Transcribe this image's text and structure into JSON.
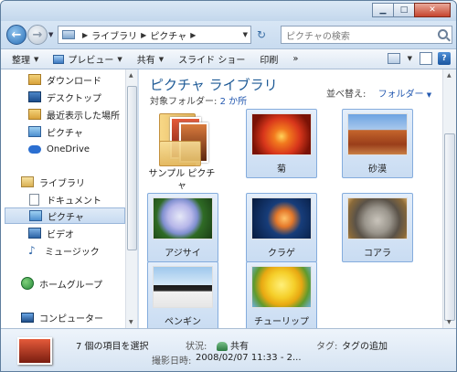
{
  "address": {
    "crumbs": [
      "ライブラリ",
      "ピクチャ"
    ]
  },
  "search": {
    "placeholder": "ピクチャの検索"
  },
  "toolbar": {
    "organize": "整理",
    "preview": "プレビュー",
    "share": "共有",
    "slideshow": "スライド ショー",
    "print": "印刷",
    "more": "»"
  },
  "navpane": {
    "favorites": [
      {
        "label": "ダウンロード",
        "icon": "download-folder-icon"
      },
      {
        "label": "デスクトップ",
        "icon": "desktop-icon"
      },
      {
        "label": "最近表示した場所",
        "icon": "recent-places-icon"
      },
      {
        "label": "ピクチャ",
        "icon": "pictures-folder-icon"
      },
      {
        "label": "OneDrive",
        "icon": "onedrive-cloud-icon"
      }
    ],
    "libraries_header": "ライブラリ",
    "libraries": [
      {
        "label": "ドキュメント",
        "icon": "documents-icon"
      },
      {
        "label": "ピクチャ",
        "icon": "pictures-library-icon"
      },
      {
        "label": "ビデオ",
        "icon": "videos-icon"
      },
      {
        "label": "ミュージック",
        "icon": "music-icon"
      }
    ],
    "homegroup": "ホームグループ",
    "computer": "コンピューター"
  },
  "content": {
    "title": "ピクチャ ライブラリ",
    "target_label": "対象フォルダー:",
    "target_link": "2 か所",
    "arrange_label": "並べ替え:",
    "arrange_value": "フォルダー"
  },
  "items": [
    {
      "label": "サンプル ピクチャ",
      "type": "folder",
      "selected": false
    },
    {
      "label": "菊",
      "type": "image",
      "selected": true
    },
    {
      "label": "砂漠",
      "type": "image",
      "selected": true
    },
    {
      "label": "アジサイ",
      "type": "image",
      "selected": true
    },
    {
      "label": "クラゲ",
      "type": "image",
      "selected": true
    },
    {
      "label": "コアラ",
      "type": "image",
      "selected": true
    },
    {
      "label": "ペンギン",
      "type": "image",
      "selected": true
    },
    {
      "label": "チューリップ",
      "type": "image",
      "selected": true
    }
  ],
  "status": {
    "count": "7 個の項目を選択",
    "state_label": "状況:",
    "state_value": "共有",
    "tag_label": "タグ:",
    "tag_value": "タグの追加",
    "date_label": "撮影日時:",
    "date_value": "2008/02/07 11:33 - 2..."
  },
  "colors": {
    "accent": "#1e5a96",
    "selection": "#c9dcf2"
  }
}
